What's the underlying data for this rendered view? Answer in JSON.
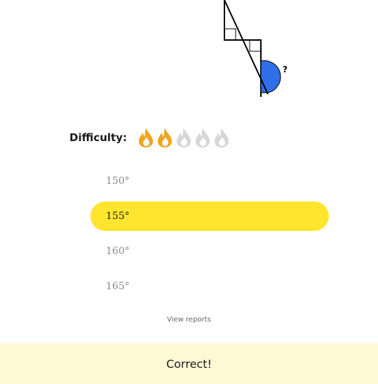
{
  "diagram": {
    "question_mark": "?",
    "arc_color": "#2f6fe8"
  },
  "difficulty": {
    "label": "Difficulty:",
    "level": 2,
    "max": 5,
    "active_color": "#f0a51e",
    "inactive_color": "#d6d6d6"
  },
  "choices": [
    {
      "label": "150°",
      "selected": false
    },
    {
      "label": "155°",
      "selected": true
    },
    {
      "label": "160°",
      "selected": false
    },
    {
      "label": "165°",
      "selected": false
    }
  ],
  "colors": {
    "selected_bg": "#ffe52e",
    "status_bg": "#fff8d4"
  },
  "view_reports": "View reports",
  "status": {
    "text": "Correct!"
  }
}
